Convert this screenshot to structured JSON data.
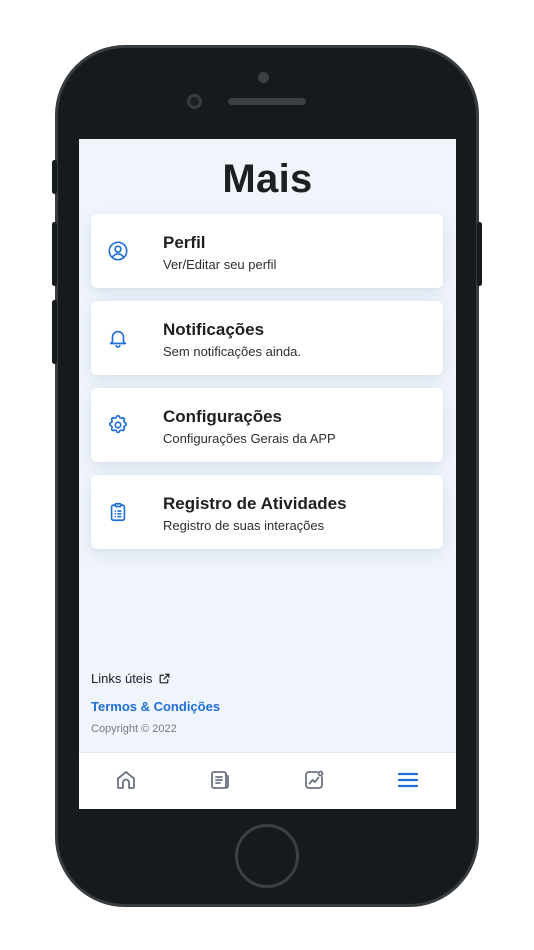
{
  "page": {
    "title": "Mais"
  },
  "menu": [
    {
      "icon": "user-circle-icon",
      "title": "Perfil",
      "subtitle": "Ver/Editar seu perfil"
    },
    {
      "icon": "bell-icon",
      "title": "Notificações",
      "subtitle": "Sem notificações ainda."
    },
    {
      "icon": "gear-icon",
      "title": "Configurações",
      "subtitle": "Configurações Gerais da APP"
    },
    {
      "icon": "clipboard-list-icon",
      "title": "Registro de Atividades",
      "subtitle": "Registro de suas interações"
    }
  ],
  "footer": {
    "links_label": "Links úteis",
    "links_icon": "external-link-icon",
    "terms_label": "Termos & Condições",
    "copyright": "Copyright © 2022"
  },
  "tabbar": {
    "items": [
      {
        "icon": "home-icon",
        "active": false
      },
      {
        "icon": "news-icon",
        "active": false
      },
      {
        "icon": "chart-icon",
        "active": false
      },
      {
        "icon": "menu-icon",
        "active": true
      }
    ]
  },
  "colors": {
    "accent": "#1f6fd6",
    "screen_background": "#f0f5fc",
    "inactive_icon": "#6b7280",
    "phone_body": "#151a1c"
  }
}
